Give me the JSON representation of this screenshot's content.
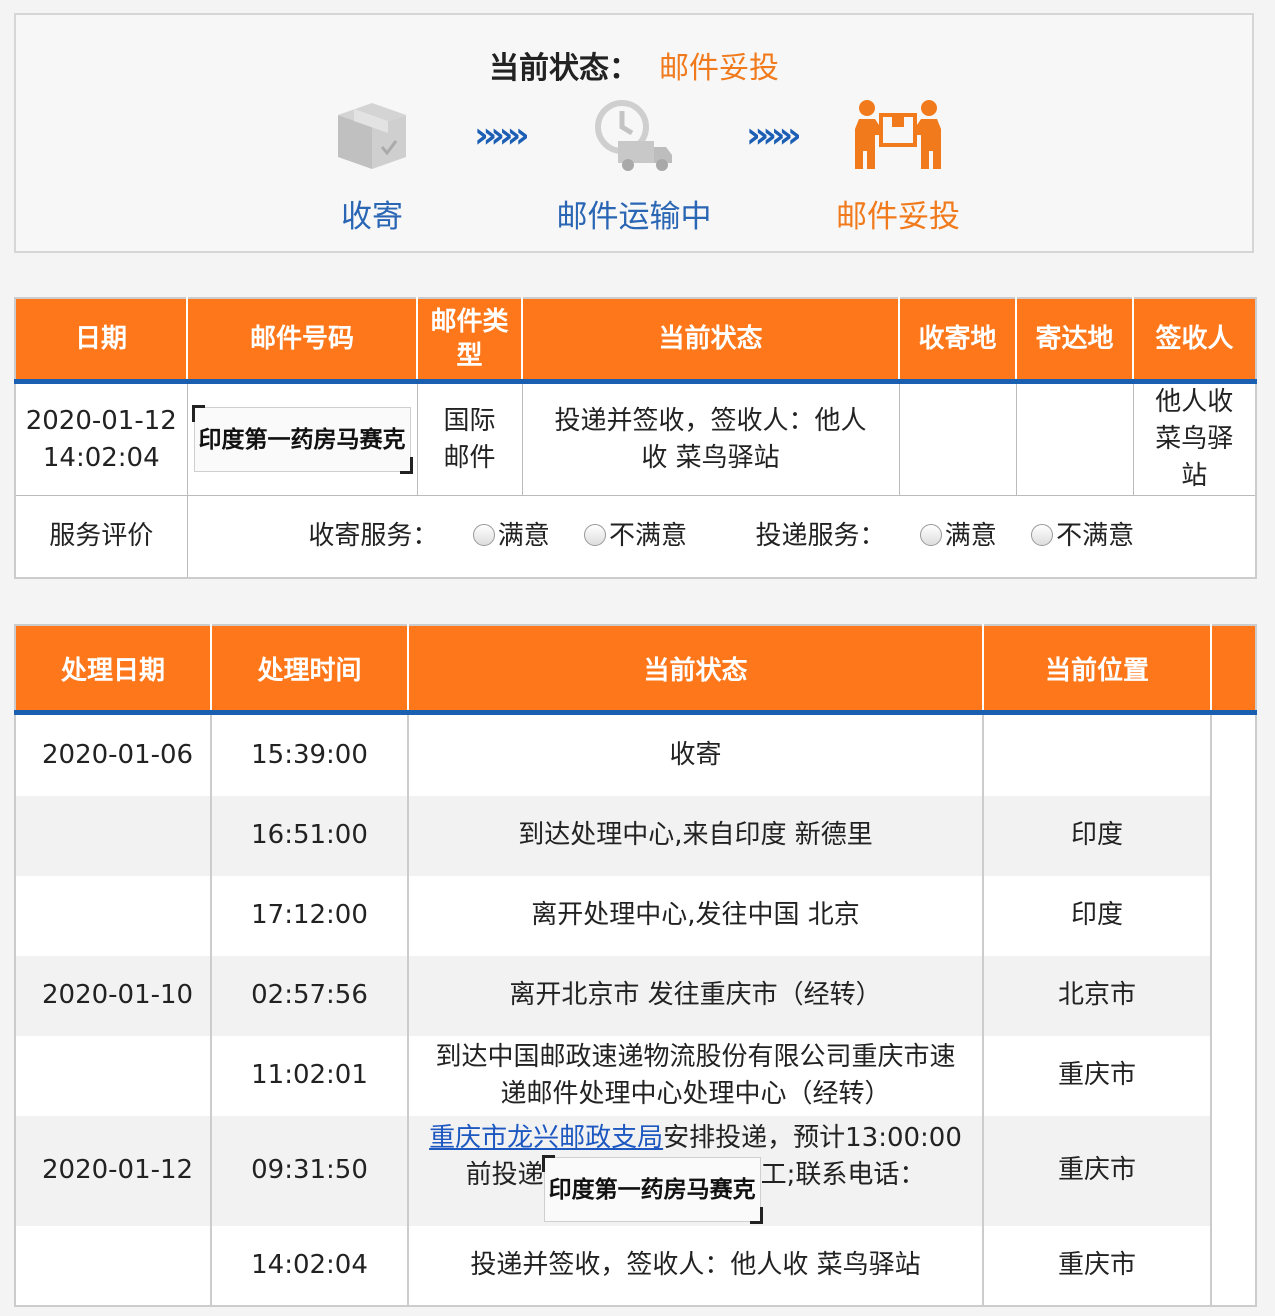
{
  "status_header": {
    "label": "当前状态：",
    "value": "邮件妥投",
    "steps": [
      {
        "label": "收寄",
        "icon": "package-box-icon",
        "color": "#2a66b4"
      },
      {
        "label": "邮件运输中",
        "icon": "delivery-truck-icon",
        "color": "#2a66b4"
      },
      {
        "label": "邮件妥投",
        "icon": "handover-people-icon",
        "color": "#f07a1c"
      }
    ],
    "arrow_glyph": "»»»"
  },
  "summary_table": {
    "headers": [
      "日期",
      "邮件号码",
      "邮件类型",
      "当前状态",
      "收寄地",
      "寄达地",
      "签收人"
    ],
    "row": {
      "date": "2020-01-12 14:02:04",
      "tracking_stamp": "印度第一药房马赛克",
      "mail_type": "国际邮件",
      "status": "投递并签收，签收人：他人收 菜鸟驿站",
      "origin": "",
      "destination": "",
      "signer": "他人收菜鸟驿站"
    },
    "evaluation": {
      "label": "服务评价",
      "collect_label": "收寄服务：",
      "deliver_label": "投递服务：",
      "option_satisfied": "满意",
      "option_unsatisfied": "不满意"
    }
  },
  "events_table": {
    "headers": [
      "处理日期",
      "处理时间",
      "当前状态",
      "当前位置"
    ],
    "rows": [
      {
        "date": "2020-01-06",
        "time": "15:39:00",
        "status": "收寄",
        "location": ""
      },
      {
        "date": "",
        "time": "16:51:00",
        "status": "到达处理中心,来自印度 新德里",
        "location": "印度"
      },
      {
        "date": "",
        "time": "17:12:00",
        "status": "离开处理中心,发往中国 北京",
        "location": "印度"
      },
      {
        "date": "2020-01-10",
        "time": "02:57:56",
        "status": "离开北京市 发往重庆市（经转）",
        "location": "北京市"
      },
      {
        "date": "",
        "time": "11:02:01",
        "status": "到达中国邮政速递物流股份有限公司重庆市速递邮件处理中心处理中心（经转）",
        "location": "重庆市"
      },
      {
        "date": "2020-01-12",
        "time": "09:31:50",
        "status_link": "重庆市龙兴邮政支局",
        "status_after_link": "安排投递，预计13:00:00前投递",
        "status_mid": "工;联系电话：",
        "status_stamp": "印度第一药房马赛克",
        "location": "重庆市"
      },
      {
        "date": "",
        "time": "14:02:04",
        "status": "投递并签收，签收人：他人收 菜鸟驿站",
        "location": "重庆市"
      }
    ]
  }
}
